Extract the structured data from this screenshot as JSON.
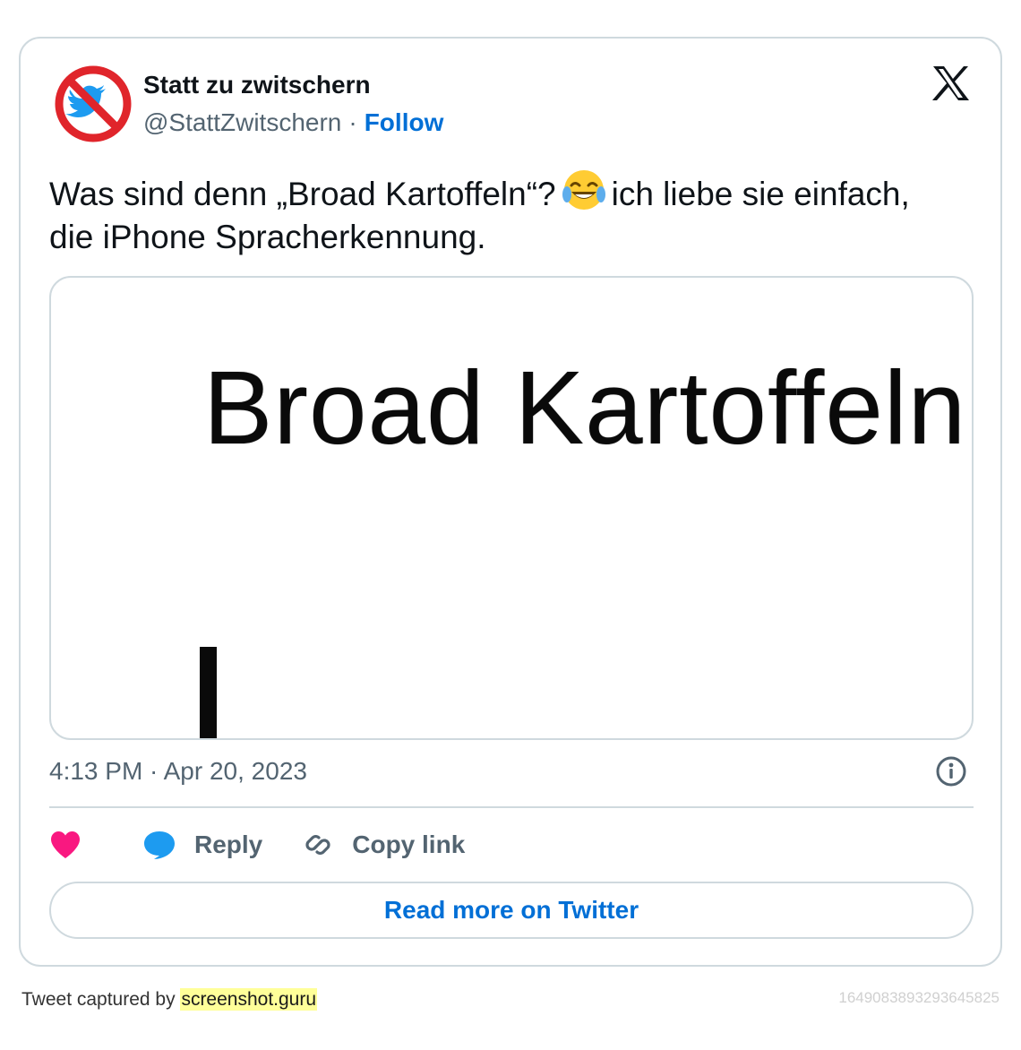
{
  "tweet": {
    "author_name": "Statt zu zwitschern",
    "handle": "@StattZwitschern",
    "separator": "·",
    "follow_label": "Follow",
    "text_before_emoji": "Was sind denn „Broad Kartoffeln“?",
    "emoji": "face-with-tears-of-joy",
    "text_after_emoji": "ich liebe sie einfach, die iPhone Spracherkennung.",
    "media_text": "Broad Kartoffeln",
    "timestamp": "4:13 PM · Apr 20, 2023",
    "actions": {
      "reply_label": "Reply",
      "copy_label": "Copy link"
    },
    "read_more_label": "Read more on Twitter"
  },
  "footer": {
    "captured_prefix": "Tweet captured by ",
    "captured_brand": "screenshot.guru",
    "tweet_id": "1649083893293645825"
  },
  "colors": {
    "link": "#006fd6",
    "heart": "#f91880",
    "reply": "#1d9bf0",
    "muted": "#536471",
    "border": "#cfd9de",
    "brand_highlight": "#ffff99"
  }
}
